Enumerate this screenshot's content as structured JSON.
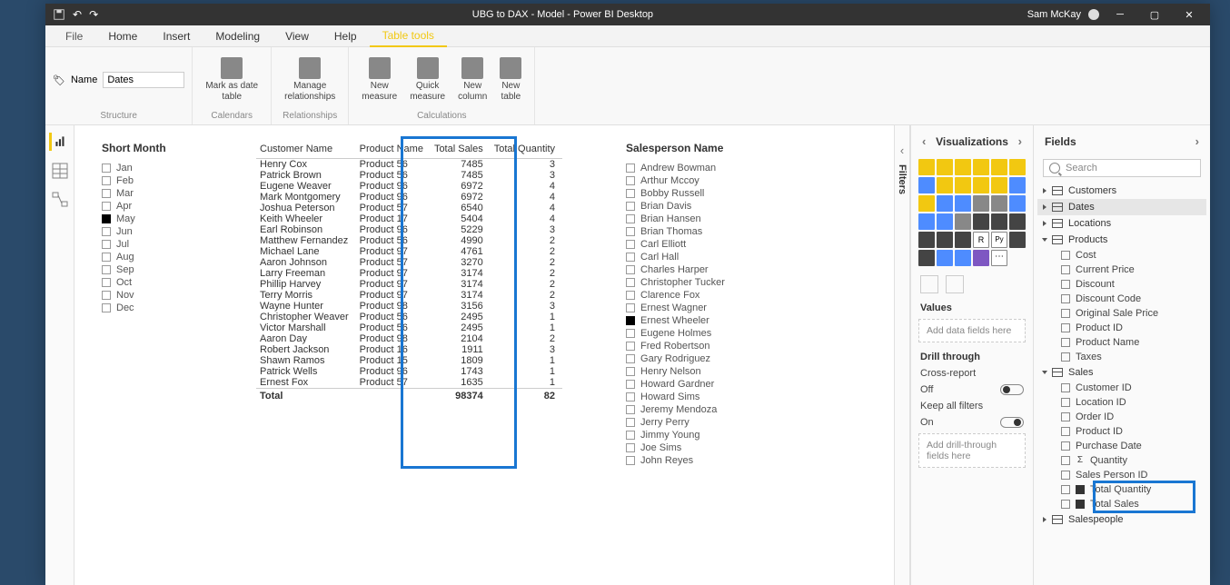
{
  "title": "UBG to DAX - Model - Power BI Desktop",
  "user": "Sam McKay",
  "ribbonTabs": [
    "File",
    "Home",
    "Insert",
    "Modeling",
    "View",
    "Help",
    "Table tools"
  ],
  "activeRibbonTab": "Table tools",
  "nameField": {
    "label": "Name",
    "value": "Dates"
  },
  "ribbonGroups": {
    "structure": "Structure",
    "calendars": "Calendars",
    "relationships": "Relationships",
    "calculations": "Calculations"
  },
  "ribbonButtons": {
    "markAsDate": "Mark as date\ntable",
    "manageRel": "Manage\nrelationships",
    "newMeasure": "New\nmeasure",
    "quickMeasure": "Quick\nmeasure",
    "newColumn": "New\ncolumn",
    "newTable": "New\ntable"
  },
  "monthSlicer": {
    "title": "Short Month",
    "items": [
      {
        "label": "Jan",
        "checked": false
      },
      {
        "label": "Feb",
        "checked": false
      },
      {
        "label": "Mar",
        "checked": false
      },
      {
        "label": "Apr",
        "checked": false
      },
      {
        "label": "May",
        "checked": true
      },
      {
        "label": "Jun",
        "checked": false
      },
      {
        "label": "Jul",
        "checked": false
      },
      {
        "label": "Aug",
        "checked": false
      },
      {
        "label": "Sep",
        "checked": false
      },
      {
        "label": "Oct",
        "checked": false
      },
      {
        "label": "Nov",
        "checked": false
      },
      {
        "label": "Dec",
        "checked": false
      }
    ]
  },
  "salesTable": {
    "columns": [
      "Customer Name",
      "Product Name",
      "Total Sales",
      "Total Quantity"
    ],
    "rows": [
      [
        "Henry Cox",
        "Product 56",
        "7485",
        "3"
      ],
      [
        "Patrick Brown",
        "Product 56",
        "7485",
        "3"
      ],
      [
        "Eugene Weaver",
        "Product 96",
        "6972",
        "4"
      ],
      [
        "Mark Montgomery",
        "Product 96",
        "6972",
        "4"
      ],
      [
        "Joshua Peterson",
        "Product 57",
        "6540",
        "4"
      ],
      [
        "Keith Wheeler",
        "Product 17",
        "5404",
        "4"
      ],
      [
        "Earl Robinson",
        "Product 96",
        "5229",
        "3"
      ],
      [
        "Matthew Fernandez",
        "Product 56",
        "4990",
        "2"
      ],
      [
        "Michael Lane",
        "Product 97",
        "4761",
        "2"
      ],
      [
        "Aaron Johnson",
        "Product 57",
        "3270",
        "2"
      ],
      [
        "Larry Freeman",
        "Product 97",
        "3174",
        "2"
      ],
      [
        "Phillip Harvey",
        "Product 97",
        "3174",
        "2"
      ],
      [
        "Terry Morris",
        "Product 97",
        "3174",
        "2"
      ],
      [
        "Wayne Hunter",
        "Product 98",
        "3156",
        "3"
      ],
      [
        "Christopher Weaver",
        "Product 56",
        "2495",
        "1"
      ],
      [
        "Victor Marshall",
        "Product 56",
        "2495",
        "1"
      ],
      [
        "Aaron Day",
        "Product 98",
        "2104",
        "2"
      ],
      [
        "Robert Jackson",
        "Product 16",
        "1911",
        "3"
      ],
      [
        "Shawn Ramos",
        "Product 15",
        "1809",
        "1"
      ],
      [
        "Patrick Wells",
        "Product 96",
        "1743",
        "1"
      ],
      [
        "Ernest Fox",
        "Product 57",
        "1635",
        "1"
      ]
    ],
    "footer": {
      "label": "Total",
      "sales": "98374",
      "qty": "82"
    }
  },
  "salespersonSlicer": {
    "title": "Salesperson Name",
    "items": [
      {
        "label": "Andrew Bowman",
        "checked": false
      },
      {
        "label": "Arthur Mccoy",
        "checked": false
      },
      {
        "label": "Bobby Russell",
        "checked": false
      },
      {
        "label": "Brian Davis",
        "checked": false
      },
      {
        "label": "Brian Hansen",
        "checked": false
      },
      {
        "label": "Brian Thomas",
        "checked": false
      },
      {
        "label": "Carl Elliott",
        "checked": false
      },
      {
        "label": "Carl Hall",
        "checked": false
      },
      {
        "label": "Charles Harper",
        "checked": false
      },
      {
        "label": "Christopher Tucker",
        "checked": false
      },
      {
        "label": "Clarence Fox",
        "checked": false
      },
      {
        "label": "Ernest Wagner",
        "checked": false
      },
      {
        "label": "Ernest Wheeler",
        "checked": true
      },
      {
        "label": "Eugene Holmes",
        "checked": false
      },
      {
        "label": "Fred Robertson",
        "checked": false
      },
      {
        "label": "Gary Rodriguez",
        "checked": false
      },
      {
        "label": "Henry Nelson",
        "checked": false
      },
      {
        "label": "Howard Gardner",
        "checked": false
      },
      {
        "label": "Howard Sims",
        "checked": false
      },
      {
        "label": "Jeremy Mendoza",
        "checked": false
      },
      {
        "label": "Jerry Perry",
        "checked": false
      },
      {
        "label": "Jimmy Young",
        "checked": false
      },
      {
        "label": "Joe Sims",
        "checked": false
      },
      {
        "label": "John Reyes",
        "checked": false
      }
    ]
  },
  "filtersLabel": "Filters",
  "vizPane": {
    "title": "Visualizations",
    "valuesLabel": "Values",
    "valuesWell": "Add data fields here",
    "drillLabel": "Drill through",
    "crossReportLabel": "Cross-report",
    "crossReportValue": "Off",
    "keepFiltersLabel": "Keep all filters",
    "keepFiltersValue": "On",
    "drillWell": "Add drill-through fields here"
  },
  "fieldsPane": {
    "title": "Fields",
    "searchPlaceholder": "Search",
    "tables": [
      {
        "name": "Customers",
        "expanded": false,
        "selected": false
      },
      {
        "name": "Dates",
        "expanded": false,
        "selected": true
      },
      {
        "name": "Locations",
        "expanded": false,
        "selected": false
      },
      {
        "name": "Products",
        "expanded": true,
        "selected": false,
        "fields": [
          {
            "name": "Cost",
            "type": "col"
          },
          {
            "name": "Current Price",
            "type": "col"
          },
          {
            "name": "Discount",
            "type": "col"
          },
          {
            "name": "Discount Code",
            "type": "col"
          },
          {
            "name": "Original Sale Price",
            "type": "col"
          },
          {
            "name": "Product ID",
            "type": "col"
          },
          {
            "name": "Product Name",
            "type": "col"
          },
          {
            "name": "Taxes",
            "type": "col"
          }
        ]
      },
      {
        "name": "Sales",
        "expanded": true,
        "selected": false,
        "fields": [
          {
            "name": "Customer ID",
            "type": "col"
          },
          {
            "name": "Location ID",
            "type": "col"
          },
          {
            "name": "Order ID",
            "type": "col"
          },
          {
            "name": "Product ID",
            "type": "col"
          },
          {
            "name": "Purchase Date",
            "type": "col"
          },
          {
            "name": "Quantity",
            "type": "sigma"
          },
          {
            "name": "Sales Person ID",
            "type": "col"
          },
          {
            "name": "Total Quantity",
            "type": "measure"
          },
          {
            "name": "Total Sales",
            "type": "measure"
          }
        ]
      },
      {
        "name": "Salespeople",
        "expanded": false,
        "selected": false
      }
    ]
  }
}
